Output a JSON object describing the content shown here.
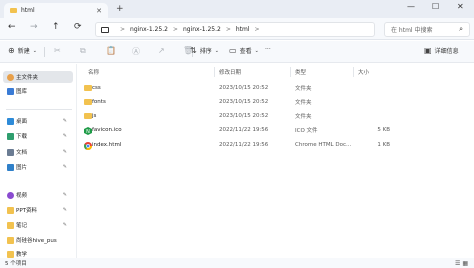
{
  "window": {
    "tab_title": "html",
    "tab_close": "✕",
    "new_tab": "+",
    "minimize": "—",
    "maximize": "☐",
    "close": "✕"
  },
  "nav": {
    "back": "←",
    "forward": "→",
    "up": "↑",
    "refresh": "⟳"
  },
  "path": {
    "segments": [
      "nginx-1.25.2",
      "nginx-1.25.2",
      "html"
    ],
    "separator": ">",
    "more": ">"
  },
  "search": {
    "placeholder": "在 html 中搜索"
  },
  "toolbar": {
    "new_label": "新建",
    "new_icon": "⊕",
    "cut_icon": "✂",
    "copy_icon": "⧉",
    "paste_icon": "📋",
    "rename_icon": "Ⓐ",
    "share_icon": "↗",
    "delete_icon": "🗑",
    "sort_label": "排序",
    "sort_icon": "⇅",
    "view_label": "查看",
    "view_icon": "▭",
    "more_label": "···",
    "details_label": "详细信息",
    "details_icon": "▣"
  },
  "sidebar": {
    "items": [
      {
        "label": "主文件夹",
        "icon": "home-icon",
        "color": "#e8a04a"
      },
      {
        "label": "图库",
        "icon": "gallery-icon",
        "color": "#3a7bd5"
      },
      {
        "label": "桌面",
        "icon": "desktop-icon",
        "color": "#2e8bd8"
      },
      {
        "label": "下载",
        "icon": "download-icon",
        "color": "#2f9e6e"
      },
      {
        "label": "文档",
        "icon": "document-icon",
        "color": "#6b7c93"
      },
      {
        "label": "图片",
        "icon": "pictures-icon",
        "color": "#2f80c9"
      },
      {
        "label": "视频",
        "icon": "video-icon",
        "color": "#8a4bd0"
      },
      {
        "label": "PPT资料",
        "icon": "folder-icon",
        "color": "#f2c24f"
      },
      {
        "label": "笔记",
        "icon": "folder-icon",
        "color": "#f2c24f"
      },
      {
        "label": "尚硅谷hive_pus",
        "icon": "folder-icon",
        "color": "#f2c24f"
      },
      {
        "label": "教学",
        "icon": "folder-icon",
        "color": "#f2c24f"
      }
    ],
    "pin": "✎"
  },
  "columns": {
    "name": "名称",
    "date": "修改日期",
    "type": "类型",
    "size": "大小"
  },
  "files": [
    {
      "name": "css",
      "date": "2023/10/15 20:52",
      "type": "文件夹",
      "size": "",
      "icon": "folder-icon"
    },
    {
      "name": "fonts",
      "date": "2023/10/15 20:52",
      "type": "文件夹",
      "size": "",
      "icon": "folder-icon"
    },
    {
      "name": "js",
      "date": "2023/10/15 20:52",
      "type": "文件夹",
      "size": "",
      "icon": "folder-icon"
    },
    {
      "name": "favicon.ico",
      "date": "2022/11/22 19:56",
      "type": "ICO 文件",
      "size": "5 KB",
      "icon": "nginx-icon"
    },
    {
      "name": "index.html",
      "date": "2022/11/22 19:56",
      "type": "Chrome HTML Doc...",
      "size": "1 KB",
      "icon": "chrome-icon"
    }
  ],
  "status": {
    "count": "5 个项目",
    "view_list": "☰",
    "view_grid": "▦"
  }
}
